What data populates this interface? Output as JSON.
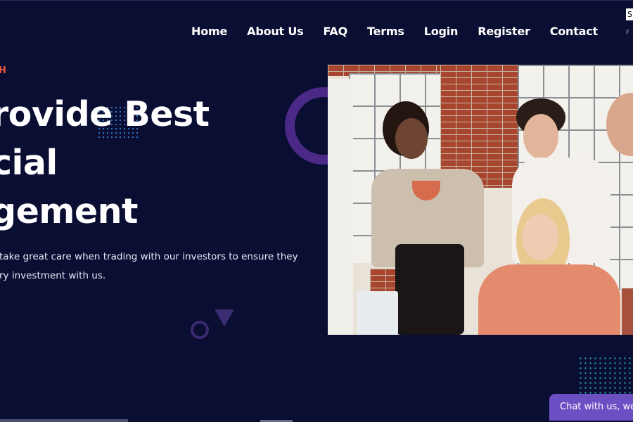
{
  "nav": {
    "items": [
      "Home",
      "About Us",
      "FAQ",
      "Terms",
      "Login",
      "Register",
      "Contact"
    ],
    "lang_box": "S",
    "lang_sub": "F"
  },
  "hero": {
    "eyebrow": "H",
    "headline_lines": [
      "rovide Best",
      "cial",
      "gement"
    ],
    "description_lines": [
      "take great care when trading with our investors to ensure they",
      "ry investment with us."
    ],
    "image_alt": "team-meeting-photo"
  },
  "chat": {
    "label": "Chat with us, we"
  },
  "colors": {
    "background": "#0b0e33",
    "accent_orange": "#f0553a",
    "accent_purple": "#4a2a86",
    "chat_purple": "#6c4fc3",
    "dot_blue": "#2f7fc8",
    "dot_teal": "#1e8c9a"
  }
}
